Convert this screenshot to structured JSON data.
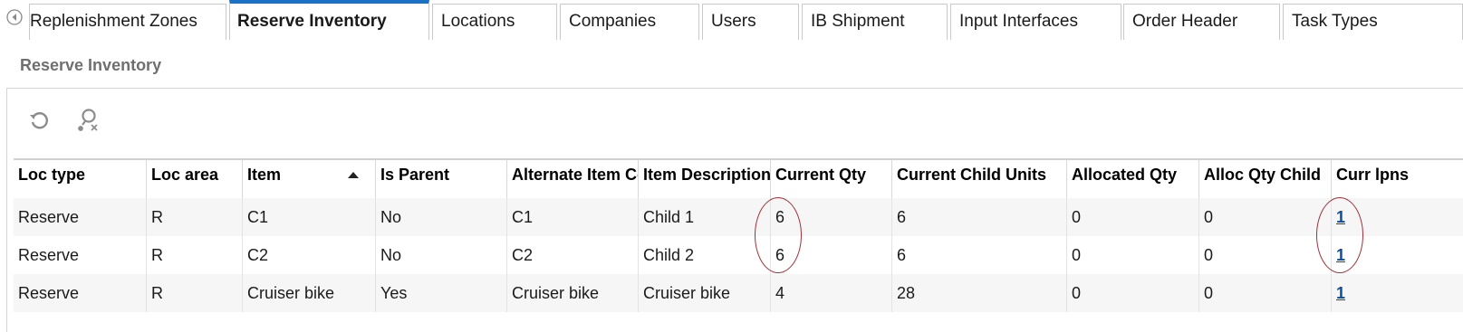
{
  "tabs": [
    {
      "label": "Replenishment Zones",
      "active": false
    },
    {
      "label": "Reserve Inventory",
      "active": true
    },
    {
      "label": "Locations",
      "active": false
    },
    {
      "label": "Companies",
      "active": false
    },
    {
      "label": "Users",
      "active": false
    },
    {
      "label": "IB Shipment",
      "active": false
    },
    {
      "label": "Input Interfaces",
      "active": false
    },
    {
      "label": "Order Header",
      "active": false
    },
    {
      "label": "Task Types",
      "active": false
    }
  ],
  "page_title": "Reserve Inventory",
  "toolbar": {
    "refresh_icon": "refresh-icon",
    "search_icon": "advanced-search-icon"
  },
  "grid": {
    "columns": [
      "Loc type",
      "Loc area",
      "Item",
      "Is Parent",
      "Alternate Item Code",
      "Item Description",
      "Current Qty",
      "Current Child Units",
      "Allocated Qty",
      "Alloc Qty Child",
      "Curr lpns"
    ],
    "sort": {
      "column": "Item",
      "direction": "ascending"
    },
    "rows": [
      [
        "Reserve",
        "R",
        "C1",
        "No",
        "C1",
        "Child 1",
        "6",
        "6",
        "0",
        "0",
        "1"
      ],
      [
        "Reserve",
        "R",
        "C2",
        "No",
        "C2",
        "Child 2",
        "6",
        "6",
        "0",
        "0",
        "1"
      ],
      [
        "Reserve",
        "R",
        "Cruiser bike",
        "Yes",
        "Cruiser bike",
        "Cruiser bike",
        "4",
        "28",
        "0",
        "0",
        "1"
      ]
    ]
  },
  "colors": {
    "accent": "#1b72c4",
    "link": "#0b4f9c",
    "annotation": "#a0303a",
    "title_gray": "#6f6f6f"
  }
}
